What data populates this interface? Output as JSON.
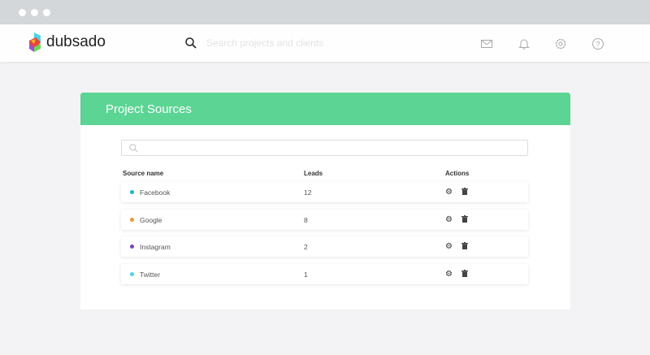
{
  "app": {
    "brand": "dubsado",
    "search_placeholder": "Search projects and clients"
  },
  "page": {
    "title": "Project Sources",
    "columns": [
      "Source name",
      "Leads",
      "Actions"
    ],
    "rows": [
      {
        "name": "Facebook",
        "leads": "12",
        "color": "#1fb3d1"
      },
      {
        "name": "Google",
        "leads": "8",
        "color": "#f0962e"
      },
      {
        "name": "Instagram",
        "leads": "2",
        "color": "#7b3fc4"
      },
      {
        "name": "Twitter",
        "leads": "1",
        "color": "#4fd3e6"
      }
    ]
  }
}
